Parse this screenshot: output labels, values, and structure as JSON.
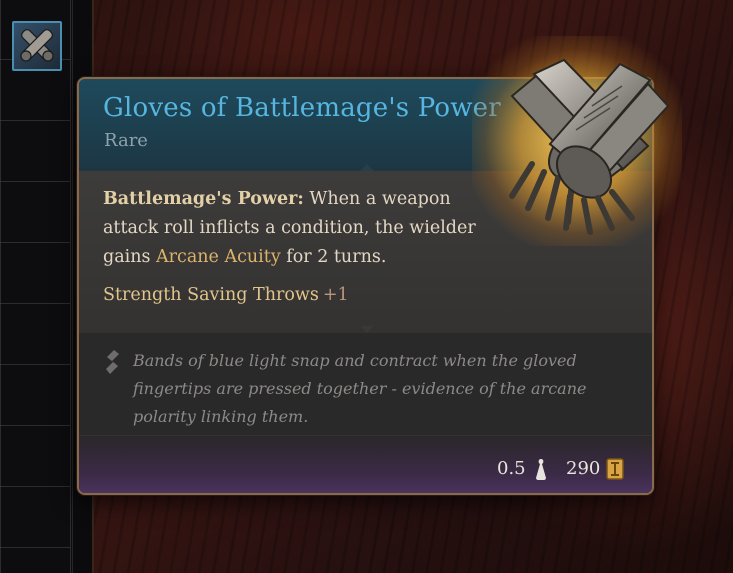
{
  "item": {
    "name": "Gloves of Battlemage's Power",
    "rarity": "Rare",
    "rarity_color": "#8fa2ac",
    "title_color": "#56b6e0",
    "passive": {
      "name": "Battlemage's Power:",
      "text_before": " When a weapon attack roll inflicts a condition, the wielder gains ",
      "condition": "Arcane Acuity",
      "text_after": " for 2 turns."
    },
    "bonus": {
      "label": "Strength Saving Throws",
      "value": "+1"
    },
    "lore": "Bands of blue light snap and contract when the gloved fingertips are pressed together - evidence of the arcane polarity linking them.",
    "weight": "0.5",
    "price": "290",
    "icons": {
      "lore": "lore-quill-icon",
      "weight": "weight-icon",
      "price": "gold-coin-icon",
      "art": "gauntlets-icon"
    }
  },
  "inventory": {
    "selected_slot_icon": "gauntlets-icon"
  }
}
